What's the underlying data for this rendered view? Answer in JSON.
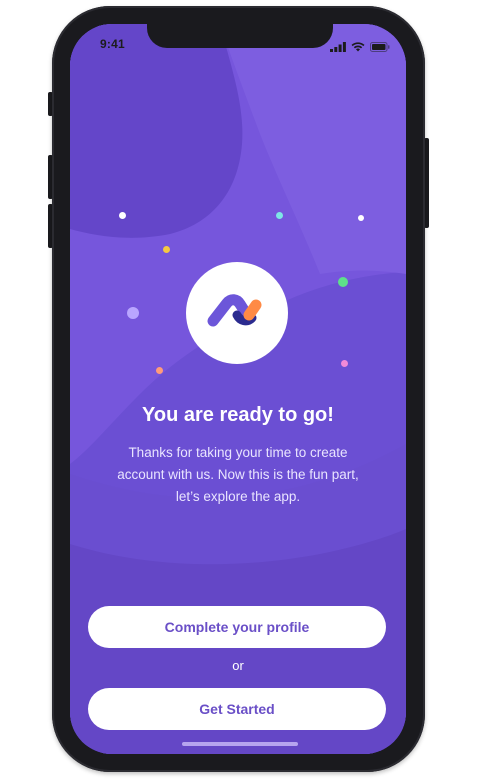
{
  "status_bar": {
    "time": "9:41",
    "icons": [
      "cellular-signal-icon",
      "wifi-icon",
      "battery-icon"
    ]
  },
  "logo": {
    "icon": "app-logo-icon",
    "colors": {
      "primary": "#6c56d9",
      "dark": "#2b2b8f",
      "accent": "#ff8a45"
    }
  },
  "onboarding": {
    "title": "You are ready to go!",
    "subtitle": "Thanks for taking your time to create account with us. Now this is the fun part, let’s explore the app."
  },
  "actions": {
    "complete_profile_label": "Complete your profile",
    "separator": "or",
    "get_started_label": "Get Started"
  },
  "theme": {
    "background": "#6b4fd3",
    "button_text": "#6a4fc7",
    "confetti": [
      "#ffffff",
      "#7ee6e6",
      "#f5c842",
      "#5ee08a",
      "#b9a6ff",
      "#ff9b7a",
      "#f28ad8"
    ]
  }
}
